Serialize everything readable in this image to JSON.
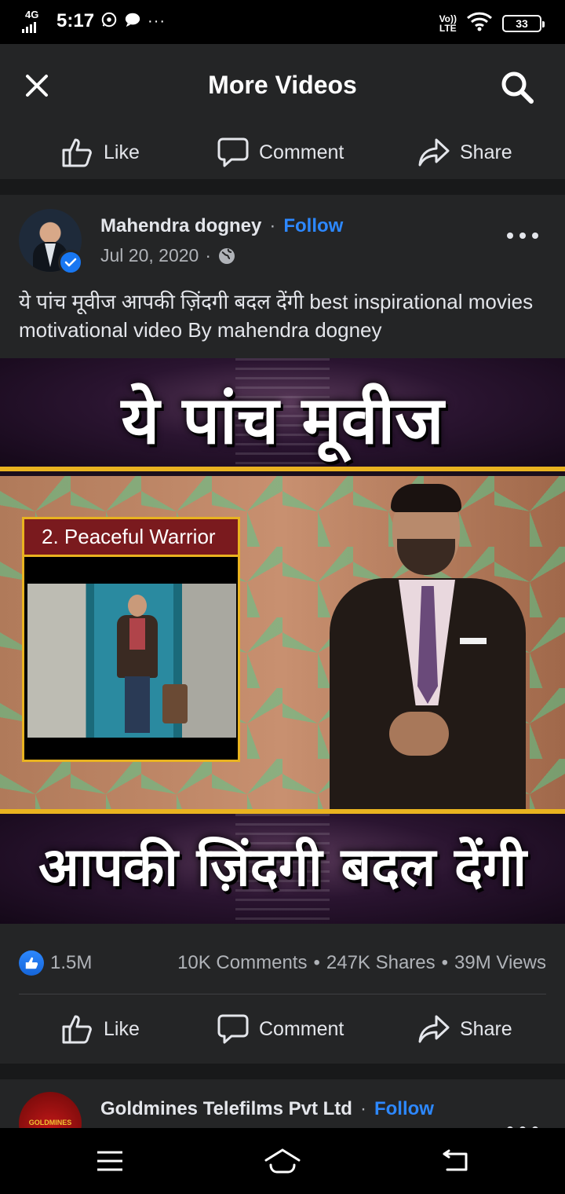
{
  "status_bar": {
    "network": "4G",
    "time": "5:17",
    "dots": "···",
    "lte_top": "Vo))",
    "lte_bottom": "LTE",
    "battery": "33"
  },
  "header": {
    "title": "More Videos",
    "close_icon": "close-icon",
    "search_icon": "search-icon"
  },
  "actions": {
    "like": "Like",
    "comment": "Comment",
    "share": "Share"
  },
  "post": {
    "author": "Mahendra dogney",
    "separator": "·",
    "follow": "Follow",
    "date": "Jul 20, 2020",
    "privacy_icon": "globe-icon",
    "caption": "ये पांच मूवीज आपकी ज़िंदगी बदल देंगी best inspirational movies motivational video By mahendra dogney",
    "video": {
      "top_text": "ये पांच मूवीज",
      "clip_label": "2. Peaceful Warrior",
      "bottom_text": "आपकी ज़िंदगी बदल देंगी"
    },
    "stats": {
      "likes": "1.5M",
      "comments": "10K Comments",
      "shares": "247K Shares",
      "views": "39M Views",
      "dot": "•"
    }
  },
  "next_post": {
    "author": "Goldmines Telefilms Pvt Ltd",
    "separator": "·",
    "follow": "Follow",
    "avatar_text": "GOLDMINES"
  },
  "colors": {
    "background": "#18191a",
    "card": "#242526",
    "accent": "#2d88ff",
    "text": "#e4e6eb",
    "muted": "#b0b3b8"
  }
}
